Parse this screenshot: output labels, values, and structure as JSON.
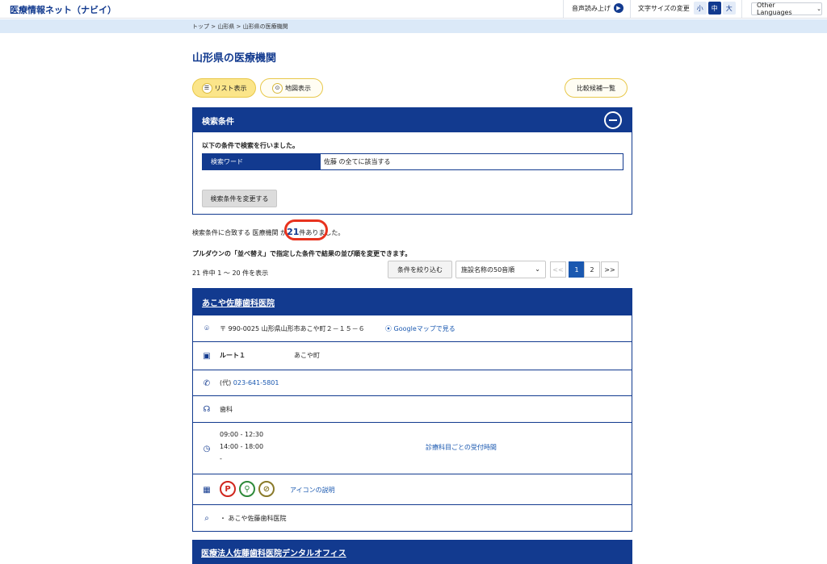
{
  "header": {
    "site_title": "医療情報ネット（ナビイ）",
    "voice_label": "音声読み上げ",
    "fontsize_label": "文字サイズの変更",
    "fontsize_options": [
      "小",
      "中",
      "大"
    ],
    "fontsize_selected": "中",
    "language_label": "Other Languages"
  },
  "breadcrumb": "トップ > 山形県 > 山形県の医療機関",
  "page_title": "山形県の医療機関",
  "view_toggle": {
    "list_label": "リスト表示",
    "map_label": "地図表示",
    "selected": "リスト表示"
  },
  "compare_label": "比較候補一覧",
  "search_conditions": {
    "title": "検索条件",
    "lead": "以下の条件で検索を行いました。",
    "key": "検索ワード",
    "value": "佐藤 の全てに該当する",
    "change_button": "検索条件を変更する"
  },
  "result": {
    "prefix": "検索条件に合致する 医療機関 が",
    "count": "21",
    "suffix": "件ありました。"
  },
  "sort_note": "プルダウンの「並べ替え」で指定した条件で結果の並び順を変更できます。",
  "range_text": "21 件中 1 ～ 20 件を表示",
  "filter_button": "条件を絞り込む",
  "sort_select": "施設名称の50音順",
  "pagination": {
    "prev": "<<",
    "pages": [
      "1",
      "2"
    ],
    "current": "1",
    "next": ">>"
  },
  "facility": {
    "name": "あこや佐藤歯科医院",
    "address": "〒 990-0025 山形県山形市あこや町２－１５－６",
    "map_link": "Googleマップで見る",
    "route_name": "ルート１",
    "route_stop": "あこや町",
    "phone_prefix": "(代)",
    "phone": "023-641-5801",
    "department": "歯科",
    "hours": [
      "09:00 - 12:30",
      "14:00 - 18:00",
      "-"
    ],
    "hours_link": "診療科目ごとの受付時間",
    "icons_link": "アイコンの説明",
    "alias": "・ あこや佐藤歯科医院",
    "colors": {
      "parking": "#d0261d",
      "barrier_free": "#2e8a3a",
      "no_smoking": "#8a7a2a"
    }
  },
  "next_facility_title": "医療法人佐藤歯科医院デンタルオフィス"
}
